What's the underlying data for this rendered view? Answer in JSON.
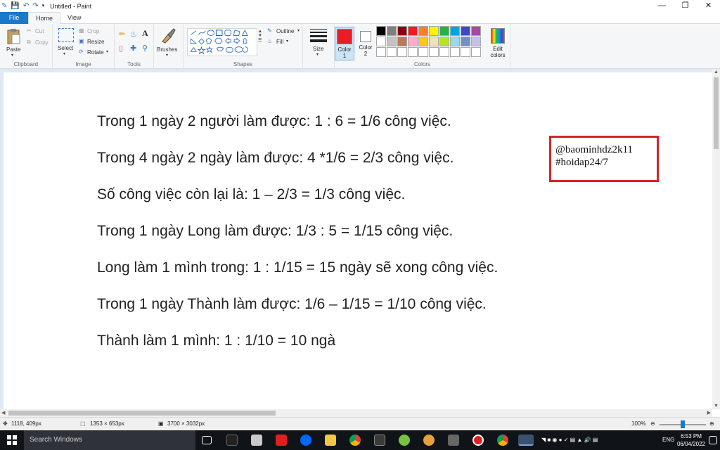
{
  "window": {
    "title": "Untitled - Paint"
  },
  "tabs": {
    "file": "File",
    "home": "Home",
    "view": "View"
  },
  "ribbon": {
    "clipboard": {
      "label": "Clipboard",
      "paste": "Paste",
      "cut": "Cut",
      "copy": "Copy"
    },
    "image": {
      "label": "Image",
      "select": "Select",
      "crop": "Crop",
      "resize": "Resize",
      "rotate": "Rotate"
    },
    "tools": {
      "label": "Tools"
    },
    "brushes": {
      "label": "Brushes"
    },
    "shapes": {
      "label": "Shapes",
      "outline": "Outline",
      "fill": "Fill"
    },
    "size": {
      "label": "Size"
    },
    "colors": {
      "label": "Colors",
      "color1": "Color\n1",
      "color1_a": "Color",
      "color1_b": "1",
      "color2_a": "Color",
      "color2_b": "2",
      "edit_a": "Edit",
      "edit_b": "colors",
      "color1_value": "#ed1c24",
      "color2_value": "#ffffff",
      "palette_row1": [
        "#000000",
        "#7f7f7f",
        "#880015",
        "#ed1c24",
        "#ff7f27",
        "#fff200",
        "#22b14c",
        "#00a2e8",
        "#3f48cc",
        "#a349a4"
      ],
      "palette_row2": [
        "#ffffff",
        "#c3c3c3",
        "#b97a57",
        "#ffaec9",
        "#ffc90e",
        "#efe4b0",
        "#b5e61d",
        "#99d9ea",
        "#7092be",
        "#c8bfe7"
      ],
      "palette_row3": [
        "#ffffff",
        "#ffffff",
        "#ffffff",
        "#ffffff",
        "#ffffff",
        "#ffffff",
        "#ffffff",
        "#ffffff",
        "#ffffff",
        "#ffffff"
      ]
    }
  },
  "canvas": {
    "lines": [
      "Trong 1 ngày 2 người làm được: 1 : 6 = 1/6 công việc.",
      "Trong 4 ngày 2 ngày làm được: 4 *1/6 = 2/3 công việc.",
      "Số công việc còn lại là: 1 – 2/3 = 1/3 công việc.",
      "Trong 1 ngày Long làm được: 1/3 : 5 = 1/15 công việc.",
      "Long làm 1 mình trong: 1 : 1/15 = 15 ngày sẽ xong công việc.",
      "Trong 1 ngày Thành làm được: 1/6 – 1/15 = 1/10 công việc.",
      "Thành làm 1 mình: 1 : 1/10 = 10 ngà"
    ],
    "watermark_line1": "@baominhdz2k11",
    "watermark_line2": "#hoidap24/7"
  },
  "status": {
    "cursor": "1118, 409px",
    "selection": "1353 × 653px",
    "image_size": "3700 × 3032px",
    "zoom": "100%"
  },
  "taskbar": {
    "search_placeholder": "Search Windows",
    "lang": "ENG",
    "time": "6:53 PM",
    "date": "06/04/2022"
  }
}
